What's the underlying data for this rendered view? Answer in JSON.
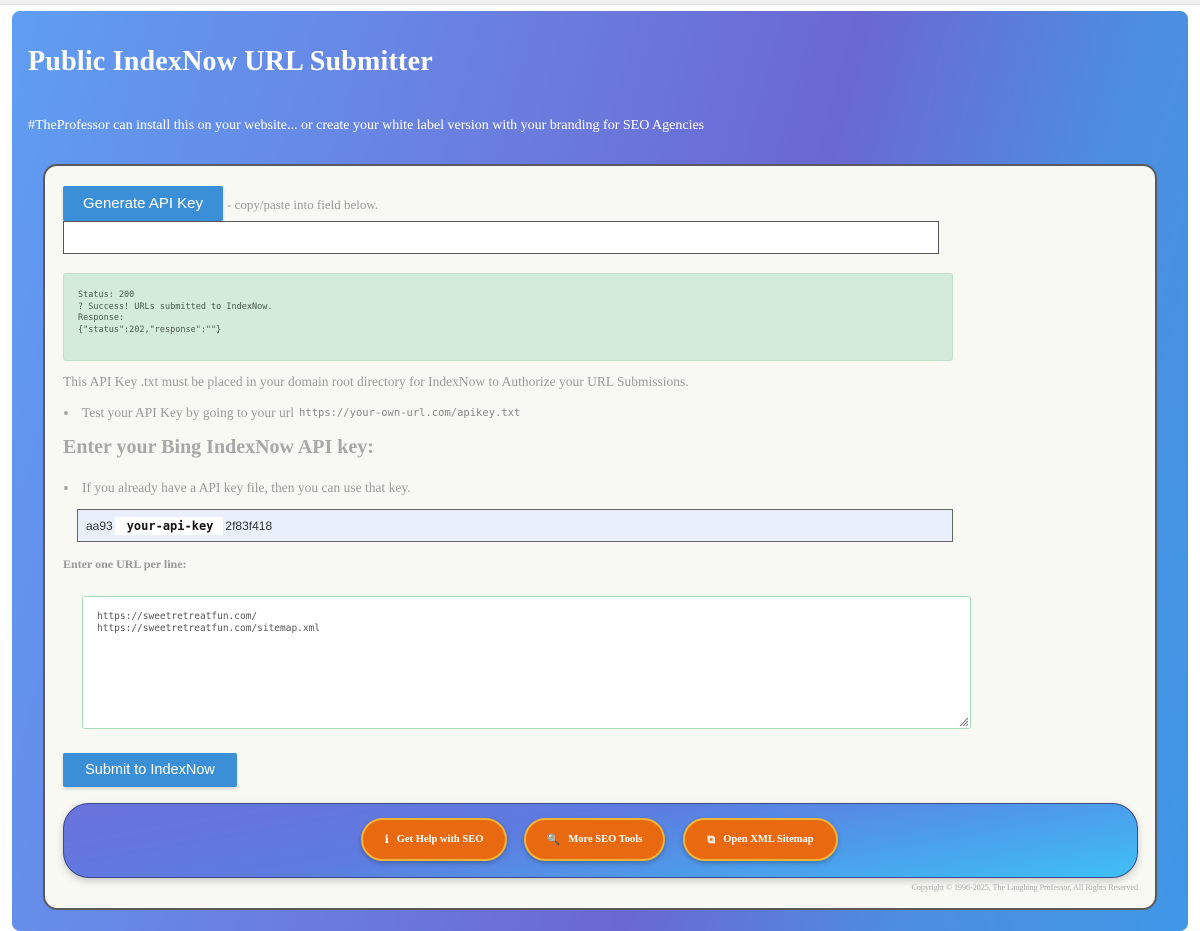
{
  "header": {
    "title": "Public IndexNow URL Submitter",
    "subtitle": "#TheProfessor can install this on your website... or create your white label version with your branding for SEO Agencies"
  },
  "generator": {
    "button_label": "Generate API Key",
    "hint": "- copy/paste into field below.",
    "output_value": ""
  },
  "status": {
    "lines": [
      "Status: 200",
      "? Success! URLs submitted to IndexNow.",
      "",
      "Response:",
      "{\"status\":202,\"response\":\"\"}"
    ]
  },
  "info": {
    "placement_note": "This API Key .txt must be placed in your domain root directory for IndexNow to Authorize your URL Submissions.",
    "test_text": "Test your API Key by going to your url",
    "test_url": "https://your-own-url.com/apikey.txt"
  },
  "api_section": {
    "heading": "Enter your Bing IndexNow API key:",
    "hint": "If you already have a API key file, then you can use that key.",
    "value_prefix": "aa93",
    "value_mask": "your-api-key",
    "value_suffix": "2f83f418"
  },
  "urls": {
    "label": "Enter one URL per line:",
    "lines": [
      "https://sweetretreatfun.com/",
      "https://sweetretreatfun.com/sitemap.xml"
    ]
  },
  "submit": {
    "label": "Submit to IndexNow"
  },
  "footer": {
    "buttons": [
      {
        "icon": "info-icon",
        "glyph": "ℹ",
        "label": "Get Help with SEO"
      },
      {
        "icon": "search-icon",
        "glyph": "🔍",
        "label": "More SEO Tools"
      },
      {
        "icon": "sitemap-icon",
        "glyph": "⧉",
        "label": "Open XML Sitemap"
      }
    ],
    "copyright": "Copyright © 1996-2025, The Laughing Professor, All Rights Reserved"
  },
  "colors": {
    "accent_blue": "#3a8fd6",
    "pill_orange": "#e8690f",
    "success_bg": "#d4eadb"
  }
}
